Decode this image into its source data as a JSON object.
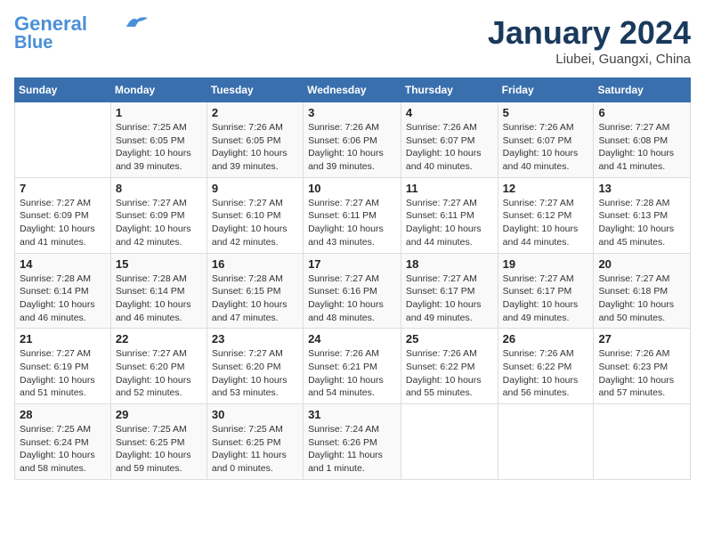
{
  "header": {
    "logo_line1": "General",
    "logo_line2": "Blue",
    "month_title": "January 2024",
    "location": "Liubei, Guangxi, China"
  },
  "days_of_week": [
    "Sunday",
    "Monday",
    "Tuesday",
    "Wednesday",
    "Thursday",
    "Friday",
    "Saturday"
  ],
  "weeks": [
    [
      {
        "num": "",
        "info": ""
      },
      {
        "num": "1",
        "info": "Sunrise: 7:25 AM\nSunset: 6:05 PM\nDaylight: 10 hours\nand 39 minutes."
      },
      {
        "num": "2",
        "info": "Sunrise: 7:26 AM\nSunset: 6:05 PM\nDaylight: 10 hours\nand 39 minutes."
      },
      {
        "num": "3",
        "info": "Sunrise: 7:26 AM\nSunset: 6:06 PM\nDaylight: 10 hours\nand 39 minutes."
      },
      {
        "num": "4",
        "info": "Sunrise: 7:26 AM\nSunset: 6:07 PM\nDaylight: 10 hours\nand 40 minutes."
      },
      {
        "num": "5",
        "info": "Sunrise: 7:26 AM\nSunset: 6:07 PM\nDaylight: 10 hours\nand 40 minutes."
      },
      {
        "num": "6",
        "info": "Sunrise: 7:27 AM\nSunset: 6:08 PM\nDaylight: 10 hours\nand 41 minutes."
      }
    ],
    [
      {
        "num": "7",
        "info": "Sunrise: 7:27 AM\nSunset: 6:09 PM\nDaylight: 10 hours\nand 41 minutes."
      },
      {
        "num": "8",
        "info": "Sunrise: 7:27 AM\nSunset: 6:09 PM\nDaylight: 10 hours\nand 42 minutes."
      },
      {
        "num": "9",
        "info": "Sunrise: 7:27 AM\nSunset: 6:10 PM\nDaylight: 10 hours\nand 42 minutes."
      },
      {
        "num": "10",
        "info": "Sunrise: 7:27 AM\nSunset: 6:11 PM\nDaylight: 10 hours\nand 43 minutes."
      },
      {
        "num": "11",
        "info": "Sunrise: 7:27 AM\nSunset: 6:11 PM\nDaylight: 10 hours\nand 44 minutes."
      },
      {
        "num": "12",
        "info": "Sunrise: 7:27 AM\nSunset: 6:12 PM\nDaylight: 10 hours\nand 44 minutes."
      },
      {
        "num": "13",
        "info": "Sunrise: 7:28 AM\nSunset: 6:13 PM\nDaylight: 10 hours\nand 45 minutes."
      }
    ],
    [
      {
        "num": "14",
        "info": "Sunrise: 7:28 AM\nSunset: 6:14 PM\nDaylight: 10 hours\nand 46 minutes."
      },
      {
        "num": "15",
        "info": "Sunrise: 7:28 AM\nSunset: 6:14 PM\nDaylight: 10 hours\nand 46 minutes."
      },
      {
        "num": "16",
        "info": "Sunrise: 7:28 AM\nSunset: 6:15 PM\nDaylight: 10 hours\nand 47 minutes."
      },
      {
        "num": "17",
        "info": "Sunrise: 7:27 AM\nSunset: 6:16 PM\nDaylight: 10 hours\nand 48 minutes."
      },
      {
        "num": "18",
        "info": "Sunrise: 7:27 AM\nSunset: 6:17 PM\nDaylight: 10 hours\nand 49 minutes."
      },
      {
        "num": "19",
        "info": "Sunrise: 7:27 AM\nSunset: 6:17 PM\nDaylight: 10 hours\nand 49 minutes."
      },
      {
        "num": "20",
        "info": "Sunrise: 7:27 AM\nSunset: 6:18 PM\nDaylight: 10 hours\nand 50 minutes."
      }
    ],
    [
      {
        "num": "21",
        "info": "Sunrise: 7:27 AM\nSunset: 6:19 PM\nDaylight: 10 hours\nand 51 minutes."
      },
      {
        "num": "22",
        "info": "Sunrise: 7:27 AM\nSunset: 6:20 PM\nDaylight: 10 hours\nand 52 minutes."
      },
      {
        "num": "23",
        "info": "Sunrise: 7:27 AM\nSunset: 6:20 PM\nDaylight: 10 hours\nand 53 minutes."
      },
      {
        "num": "24",
        "info": "Sunrise: 7:26 AM\nSunset: 6:21 PM\nDaylight: 10 hours\nand 54 minutes."
      },
      {
        "num": "25",
        "info": "Sunrise: 7:26 AM\nSunset: 6:22 PM\nDaylight: 10 hours\nand 55 minutes."
      },
      {
        "num": "26",
        "info": "Sunrise: 7:26 AM\nSunset: 6:22 PM\nDaylight: 10 hours\nand 56 minutes."
      },
      {
        "num": "27",
        "info": "Sunrise: 7:26 AM\nSunset: 6:23 PM\nDaylight: 10 hours\nand 57 minutes."
      }
    ],
    [
      {
        "num": "28",
        "info": "Sunrise: 7:25 AM\nSunset: 6:24 PM\nDaylight: 10 hours\nand 58 minutes."
      },
      {
        "num": "29",
        "info": "Sunrise: 7:25 AM\nSunset: 6:25 PM\nDaylight: 10 hours\nand 59 minutes."
      },
      {
        "num": "30",
        "info": "Sunrise: 7:25 AM\nSunset: 6:25 PM\nDaylight: 11 hours\nand 0 minutes."
      },
      {
        "num": "31",
        "info": "Sunrise: 7:24 AM\nSunset: 6:26 PM\nDaylight: 11 hours\nand 1 minute."
      },
      {
        "num": "",
        "info": ""
      },
      {
        "num": "",
        "info": ""
      },
      {
        "num": "",
        "info": ""
      }
    ]
  ]
}
